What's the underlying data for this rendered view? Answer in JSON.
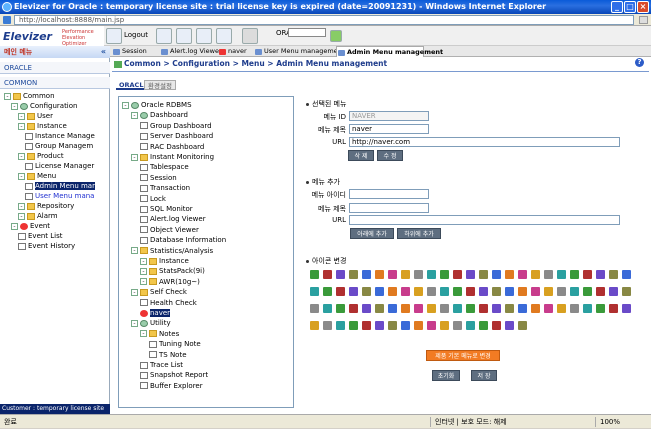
{
  "window": {
    "title": "Elevizer for Oracle : temporary license site : trial license key is expired (date=20091231) - Windows Internet Explorer",
    "url": "http://localhost:8888/main.jsp"
  },
  "app": {
    "logo": "Elevizer",
    "logo_sub": "Performance Elevation Optimizer"
  },
  "toolbar": {
    "logout": "Logout",
    "db_label": "ORA -",
    "db_value": ""
  },
  "tabs": [
    {
      "label": "Session"
    },
    {
      "label": "Alert.log Viewer"
    },
    {
      "label": "naver"
    },
    {
      "label": "User Menu management"
    },
    {
      "label": "Admin Menu management"
    }
  ],
  "sidebar": {
    "header": "메인 메뉴",
    "collapse": "«",
    "categories": [
      "ORACLE",
      "COMMON"
    ],
    "tree": [
      {
        "label": "Common",
        "level": 0,
        "kind": "folder"
      },
      {
        "label": "Configuration",
        "level": 1,
        "kind": "gear"
      },
      {
        "label": "User",
        "level": 2,
        "kind": "folder"
      },
      {
        "label": "Instance",
        "level": 2,
        "kind": "folder"
      },
      {
        "label": "Instance Manage",
        "level": 3,
        "kind": "doc"
      },
      {
        "label": "Group Managem",
        "level": 3,
        "kind": "doc"
      },
      {
        "label": "Product",
        "level": 2,
        "kind": "folder"
      },
      {
        "label": "License Manager",
        "level": 3,
        "kind": "doc"
      },
      {
        "label": "Menu",
        "level": 2,
        "kind": "folder"
      },
      {
        "label": "Admin Menu mar",
        "level": 3,
        "kind": "doc",
        "selected": true
      },
      {
        "label": "User Menu mana",
        "level": 3,
        "kind": "doc",
        "link": true
      },
      {
        "label": "Repository",
        "level": 2,
        "kind": "folder"
      },
      {
        "label": "Alarm",
        "level": 2,
        "kind": "folder"
      },
      {
        "label": "Event",
        "level": 1,
        "kind": "red"
      },
      {
        "label": "Event List",
        "level": 2,
        "kind": "doc"
      },
      {
        "label": "Event History",
        "level": 2,
        "kind": "doc"
      }
    ],
    "status": "Customer : temporary license site"
  },
  "main": {
    "breadcrumb": "Common > Configuration > Menu > Admin Menu management",
    "subtabs": [
      "ORACLE",
      "환경설정"
    ],
    "menu_tree": [
      {
        "label": "Oracle RDBMS",
        "level": 0,
        "kind": "gear"
      },
      {
        "label": "Dashboard",
        "level": 1,
        "kind": "gear"
      },
      {
        "label": "Group Dashboard",
        "level": 2,
        "kind": "doc"
      },
      {
        "label": "Server Dashboard",
        "level": 2,
        "kind": "doc"
      },
      {
        "label": "RAC Dashboard",
        "level": 2,
        "kind": "doc"
      },
      {
        "label": "Instant Monitoring",
        "level": 1,
        "kind": "folder"
      },
      {
        "label": "Tablespace",
        "level": 2,
        "kind": "doc"
      },
      {
        "label": "Session",
        "level": 2,
        "kind": "doc"
      },
      {
        "label": "Transaction",
        "level": 2,
        "kind": "doc"
      },
      {
        "label": "Lock",
        "level": 2,
        "kind": "doc"
      },
      {
        "label": "SQL Monitor",
        "level": 2,
        "kind": "doc"
      },
      {
        "label": "Alert.log Viewer",
        "level": 2,
        "kind": "doc"
      },
      {
        "label": "Object Viewer",
        "level": 2,
        "kind": "doc"
      },
      {
        "label": "Database Information",
        "level": 2,
        "kind": "doc"
      },
      {
        "label": "Statistics/Analysis",
        "level": 1,
        "kind": "folder"
      },
      {
        "label": "Instance",
        "level": 2,
        "kind": "folder"
      },
      {
        "label": "StatsPack(9i)",
        "level": 2,
        "kind": "folder"
      },
      {
        "label": "AWR(10g~)",
        "level": 2,
        "kind": "folder"
      },
      {
        "label": "Self Check",
        "level": 1,
        "kind": "folder"
      },
      {
        "label": "Health Check",
        "level": 2,
        "kind": "doc"
      },
      {
        "label": "naver",
        "level": 2,
        "kind": "red",
        "selected": true
      },
      {
        "label": "Utility",
        "level": 1,
        "kind": "gear"
      },
      {
        "label": "Notes",
        "level": 2,
        "kind": "folder"
      },
      {
        "label": "Tuning Note",
        "level": 3,
        "kind": "doc"
      },
      {
        "label": "TS Note",
        "level": 3,
        "kind": "doc"
      },
      {
        "label": "Trace List",
        "level": 2,
        "kind": "doc"
      },
      {
        "label": "Snapshot Report",
        "level": 2,
        "kind": "doc"
      },
      {
        "label": "Buffer Explorer",
        "level": 2,
        "kind": "doc"
      }
    ],
    "selected_menu": {
      "title": "선택된 메뉴",
      "id_label": "메뉴 ID",
      "id_value": "NAVER",
      "name_label": "메뉴 제목",
      "name_value": "naver",
      "url_label": "URL",
      "url_value": "http://naver.com",
      "delete_btn": "삭 제",
      "edit_btn": "수 정"
    },
    "add_menu": {
      "title": "메뉴 추가",
      "id_label": "메뉴 아이디",
      "id_value": "",
      "name_label": "메뉴 제목",
      "name_value": "",
      "url_label": "URL",
      "url_value": "",
      "add_below_btn": "아래에 추가",
      "add_child_btn": "하위에 추가"
    },
    "icon_change": {
      "title": "아이콘 변경"
    },
    "reset_default_btn": "제품 기본 메뉴로 변경",
    "init_btn": "초기화",
    "save_btn": "저 장"
  },
  "statusbar": {
    "done": "완료",
    "zone": "인터넷 | 보호 모드: 해제",
    "zoom": "100%"
  }
}
